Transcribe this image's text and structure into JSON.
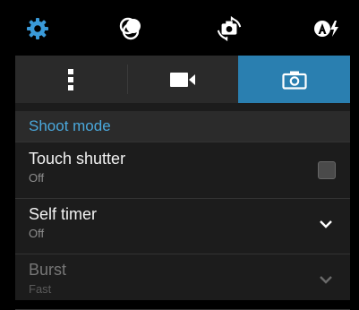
{
  "topbar": {
    "icons": [
      "gear-icon",
      "color-effects-icon",
      "switch-camera-icon",
      "auto-flash-icon"
    ],
    "accent": "#3a9ad9"
  },
  "tabs": [
    {
      "name": "more-settings",
      "icon": "vertical-dots-icon",
      "active": false
    },
    {
      "name": "video",
      "icon": "video-camera-icon",
      "active": false
    },
    {
      "name": "camera",
      "icon": "camera-icon",
      "active": true
    }
  ],
  "section": {
    "title": "Shoot mode",
    "color": "#4aa8dc"
  },
  "settings": [
    {
      "label": "Touch shutter",
      "value": "Off",
      "control": "checkbox",
      "checked": false,
      "enabled": true
    },
    {
      "label": "Self timer",
      "value": "Off",
      "control": "dropdown",
      "enabled": true
    },
    {
      "label": "Burst",
      "value": "Fast",
      "control": "dropdown",
      "enabled": false
    }
  ],
  "colors": {
    "active_tab": "#2a7fb0",
    "panel": "#1c1c1c"
  }
}
